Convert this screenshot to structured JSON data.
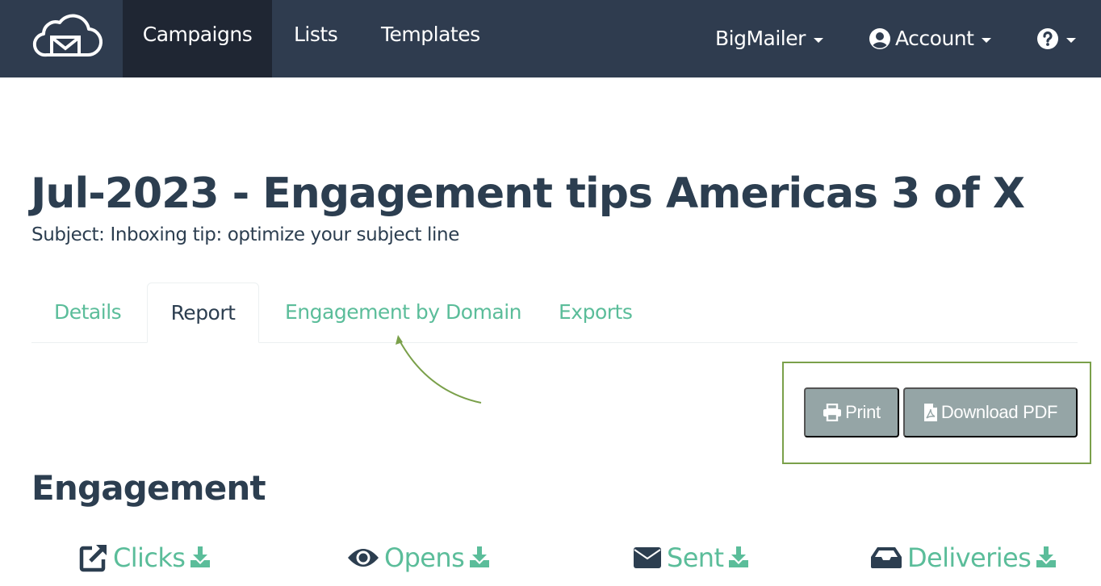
{
  "navbar": {
    "logo": "cloud-mail-logo",
    "items": [
      {
        "label": "Campaigns",
        "active": true
      },
      {
        "label": "Lists",
        "active": false
      },
      {
        "label": "Templates",
        "active": false
      }
    ],
    "right": {
      "org_label": "BigMailer",
      "account_label": "Account",
      "help_icon": "question-circle-icon"
    }
  },
  "header": {
    "title": "Jul-2023 - Engagement tips Americas 3 of X",
    "subject": "Subject: Inboxing tip: optimize your subject line"
  },
  "tabs": [
    {
      "label": "Details",
      "active": false
    },
    {
      "label": "Report",
      "active": true
    },
    {
      "label": "Engagement by Domain",
      "active": false
    },
    {
      "label": "Exports",
      "active": false
    }
  ],
  "actions": {
    "print_label": "Print",
    "pdf_label": "Download PDF"
  },
  "engagement": {
    "title": "Engagement",
    "metrics": [
      {
        "label": "Clicks",
        "icon": "external-link-icon"
      },
      {
        "label": "Opens",
        "icon": "eye-icon"
      },
      {
        "label": "Sent",
        "icon": "envelope-icon"
      },
      {
        "label": "Deliveries",
        "icon": "inbox-icon"
      }
    ]
  },
  "colors": {
    "navbar": "#2f3c4f",
    "navbar_active": "#1f2633",
    "accent": "#5bbd9a",
    "text": "#2c3e50",
    "button": "#95a5a6",
    "annotation": "#7aa04a"
  }
}
